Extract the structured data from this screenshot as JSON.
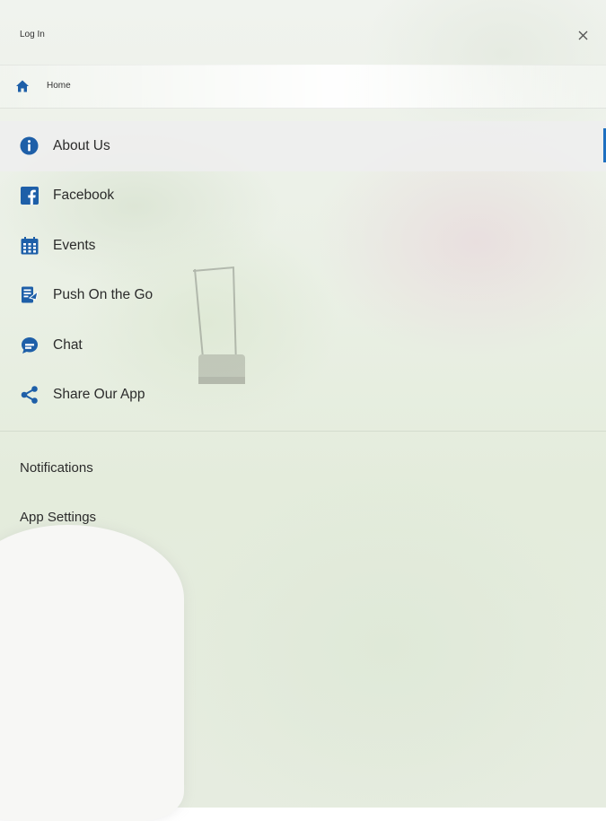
{
  "header": {
    "login_label": "Log In",
    "close_icon": "close-icon"
  },
  "home": {
    "label": "Home",
    "icon": "home-icon"
  },
  "menu": {
    "items": [
      {
        "label": "About Us",
        "icon": "info-icon",
        "active": true
      },
      {
        "label": "Facebook",
        "icon": "facebook-icon"
      },
      {
        "label": "Events",
        "icon": "calendar-icon"
      },
      {
        "label": "Push On the Go",
        "icon": "push-icon"
      },
      {
        "label": "Chat",
        "icon": "chat-icon"
      },
      {
        "label": "Share Our App",
        "icon": "share-icon"
      }
    ]
  },
  "settings": {
    "notifications_label": "Notifications",
    "app_settings_label": "App Settings"
  },
  "colors": {
    "accent": "#1e6fc0",
    "text": "#2b2b2b"
  }
}
